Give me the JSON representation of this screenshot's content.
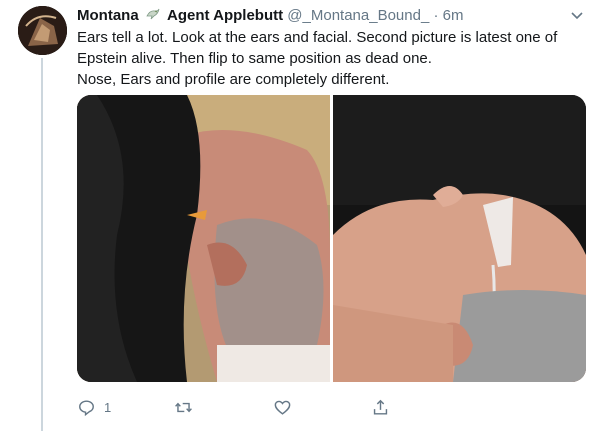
{
  "tweet": {
    "display_name": "Montana",
    "display_name_suffix": "Agent Applebutt",
    "handle": "@_Montana_Bound_",
    "separator": "·",
    "time": "6m",
    "text_lines": [
      "Ears tell a lot. Look at the ears and facial. Second picture is latest one of",
      "Epstein alive. Then flip to same position as dead one.",
      "Nose, Ears and profile are completely different."
    ],
    "name_icon": "dove-icon",
    "menu_icon": "chevron-down-icon"
  },
  "media": {
    "photos": [
      {
        "description_icon": "photo-left"
      },
      {
        "description_icon": "photo-right"
      }
    ]
  },
  "actions": {
    "reply_count": "1",
    "icons": [
      "reply-icon",
      "retweet-icon",
      "like-icon",
      "share-icon"
    ]
  },
  "colors": {
    "text": "#14171a",
    "secondary": "#657786",
    "thread_line": "#ccd6dd"
  }
}
